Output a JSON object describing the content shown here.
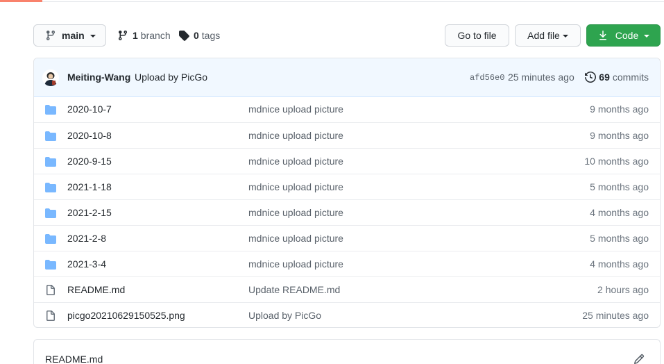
{
  "toolbar": {
    "branch_label": "main",
    "branches_count": "1",
    "branches_label": "branch",
    "tags_count": "0",
    "tags_label": "tags",
    "go_to_file_label": "Go to file",
    "add_file_label": "Add file",
    "code_label": "Code",
    "code_color": "#2ea44f"
  },
  "commit": {
    "author": "Meiting-Wang",
    "message": "Upload by PicGo",
    "sha": "afd56e0",
    "time": "25 minutes ago",
    "commits_count": "69",
    "commits_label": "commits"
  },
  "files": [
    {
      "icon": "folder-icon",
      "name": "2020-10-7",
      "message": "mdnice upload picture",
      "age": "9 months ago"
    },
    {
      "icon": "folder-icon",
      "name": "2020-10-8",
      "message": "mdnice upload picture",
      "age": "9 months ago"
    },
    {
      "icon": "folder-icon",
      "name": "2020-9-15",
      "message": "mdnice upload picture",
      "age": "10 months ago"
    },
    {
      "icon": "folder-icon",
      "name": "2021-1-18",
      "message": "mdnice upload picture",
      "age": "5 months ago"
    },
    {
      "icon": "folder-icon",
      "name": "2021-2-15",
      "message": "mdnice upload picture",
      "age": "4 months ago"
    },
    {
      "icon": "folder-icon",
      "name": "2021-2-8",
      "message": "mdnice upload picture",
      "age": "5 months ago"
    },
    {
      "icon": "folder-icon",
      "name": "2021-3-4",
      "message": "mdnice upload picture",
      "age": "4 months ago"
    },
    {
      "icon": "file-icon",
      "name": "README.md",
      "message": "Update README.md",
      "age": "2 hours ago"
    },
    {
      "icon": "file-icon",
      "name": "picgo20210629150525.png",
      "message": "Upload by PicGo",
      "age": "25 minutes ago"
    }
  ],
  "readme": {
    "title": "README.md"
  },
  "colors": {
    "folder": "#79b8ff",
    "file": "#6a737d",
    "commit_bar_bg": "#f1f8ff"
  }
}
